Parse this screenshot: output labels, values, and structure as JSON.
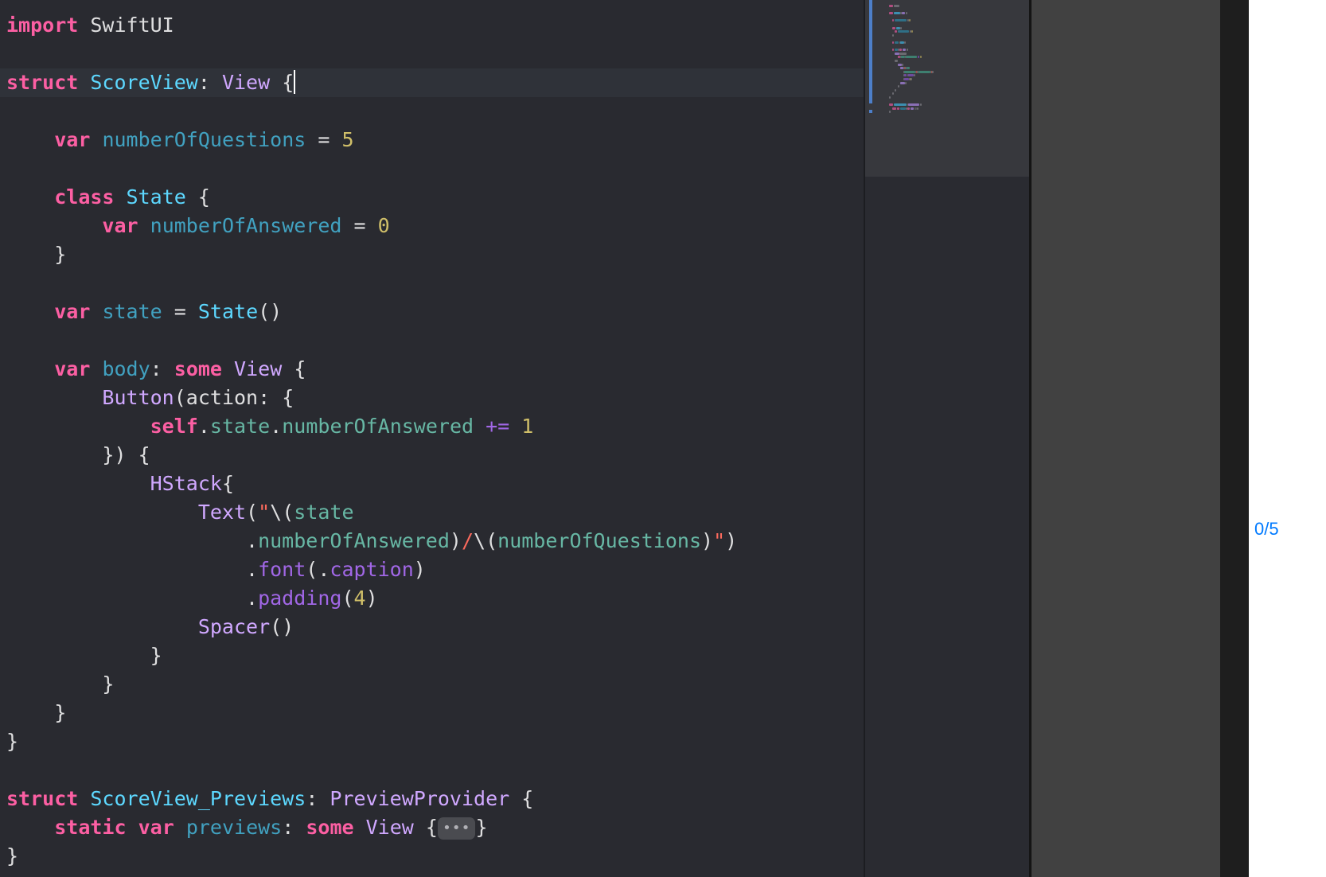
{
  "editor": {
    "lines": [
      [
        [
          "k",
          "import"
        ],
        [
          "p",
          " SwiftUI"
        ]
      ],
      [],
      [
        [
          "k",
          "struct"
        ],
        [
          "p",
          " "
        ],
        [
          "td",
          "ScoreView"
        ],
        [
          "p",
          ": "
        ],
        [
          "tu",
          "View"
        ],
        [
          "p",
          " {"
        ]
      ],
      [],
      [
        [
          "p",
          "    "
        ],
        [
          "k",
          "var"
        ],
        [
          "p",
          " "
        ],
        [
          "id",
          "numberOfQuestions"
        ],
        [
          "p",
          " = "
        ],
        [
          "n",
          "5"
        ]
      ],
      [],
      [
        [
          "p",
          "    "
        ],
        [
          "k",
          "class"
        ],
        [
          "p",
          " "
        ],
        [
          "td",
          "State"
        ],
        [
          "p",
          " {"
        ]
      ],
      [
        [
          "p",
          "        "
        ],
        [
          "k",
          "var"
        ],
        [
          "p",
          " "
        ],
        [
          "id",
          "numberOfAnswered"
        ],
        [
          "p",
          " = "
        ],
        [
          "n",
          "0"
        ]
      ],
      [
        [
          "p",
          "    }"
        ]
      ],
      [],
      [
        [
          "p",
          "    "
        ],
        [
          "k",
          "var"
        ],
        [
          "p",
          " "
        ],
        [
          "id",
          "state"
        ],
        [
          "p",
          " = "
        ],
        [
          "td",
          "State"
        ],
        [
          "p",
          "()"
        ]
      ],
      [],
      [
        [
          "p",
          "    "
        ],
        [
          "k",
          "var"
        ],
        [
          "p",
          " "
        ],
        [
          "id",
          "body"
        ],
        [
          "p",
          ": "
        ],
        [
          "k",
          "some"
        ],
        [
          "p",
          " "
        ],
        [
          "tu",
          "View"
        ],
        [
          "p",
          " {"
        ]
      ],
      [
        [
          "p",
          "        "
        ],
        [
          "tu",
          "Button"
        ],
        [
          "p",
          "(action: {"
        ]
      ],
      [
        [
          "p",
          "            "
        ],
        [
          "k",
          "self"
        ],
        [
          "p",
          "."
        ],
        [
          "fn",
          "state"
        ],
        [
          "p",
          "."
        ],
        [
          "fn",
          "numberOfAnswered"
        ],
        [
          "p",
          " "
        ],
        [
          "pr",
          "+="
        ],
        [
          "p",
          " "
        ],
        [
          "n",
          "1"
        ]
      ],
      [
        [
          "p",
          "        }) {"
        ]
      ],
      [
        [
          "p",
          "            "
        ],
        [
          "tu",
          "HStack"
        ],
        [
          "p",
          "{"
        ]
      ],
      [
        [
          "p",
          "                "
        ],
        [
          "tu",
          "Text"
        ],
        [
          "p",
          "("
        ],
        [
          "s",
          "\""
        ],
        [
          "p",
          "\\("
        ],
        [
          "fn",
          "state"
        ]
      ],
      [
        [
          "p",
          "                    ."
        ],
        [
          "fn",
          "numberOfAnswered"
        ],
        [
          "p",
          ")"
        ],
        [
          "s",
          "/"
        ],
        [
          "p",
          "\\("
        ],
        [
          "fn",
          "numberOfQuestions"
        ],
        [
          "p",
          ")"
        ],
        [
          "s",
          "\""
        ],
        [
          "p",
          ")"
        ]
      ],
      [
        [
          "p",
          "                    ."
        ],
        [
          "pr",
          "font"
        ],
        [
          "p",
          "(."
        ],
        [
          "pr",
          "caption"
        ],
        [
          "p",
          ")"
        ]
      ],
      [
        [
          "p",
          "                    ."
        ],
        [
          "pr",
          "padding"
        ],
        [
          "p",
          "("
        ],
        [
          "n",
          "4"
        ],
        [
          "p",
          ")"
        ]
      ],
      [
        [
          "p",
          "                "
        ],
        [
          "tu",
          "Spacer"
        ],
        [
          "p",
          "()"
        ]
      ],
      [
        [
          "p",
          "            }"
        ]
      ],
      [
        [
          "p",
          "        }"
        ]
      ],
      [
        [
          "p",
          "    }"
        ]
      ],
      [
        [
          "p",
          "}"
        ]
      ],
      [],
      [
        [
          "k",
          "struct"
        ],
        [
          "p",
          " "
        ],
        [
          "td",
          "ScoreView_Previews"
        ],
        [
          "p",
          ": "
        ],
        [
          "tu",
          "PreviewProvider"
        ],
        [
          "p",
          " {"
        ]
      ],
      [
        [
          "p",
          "    "
        ],
        [
          "k",
          "static"
        ],
        [
          "p",
          " "
        ],
        [
          "k",
          "var"
        ],
        [
          "p",
          " "
        ],
        [
          "id",
          "previews"
        ],
        [
          "p",
          ": "
        ],
        [
          "k",
          "some"
        ],
        [
          "p",
          " "
        ],
        [
          "tu",
          "View"
        ],
        [
          "p",
          " {"
        ],
        [
          "fold",
          "•••"
        ],
        [
          "p",
          "}"
        ]
      ],
      [
        [
          "p",
          "}"
        ]
      ]
    ],
    "current_line_index": 2
  },
  "preview": {
    "text": "0/5"
  }
}
